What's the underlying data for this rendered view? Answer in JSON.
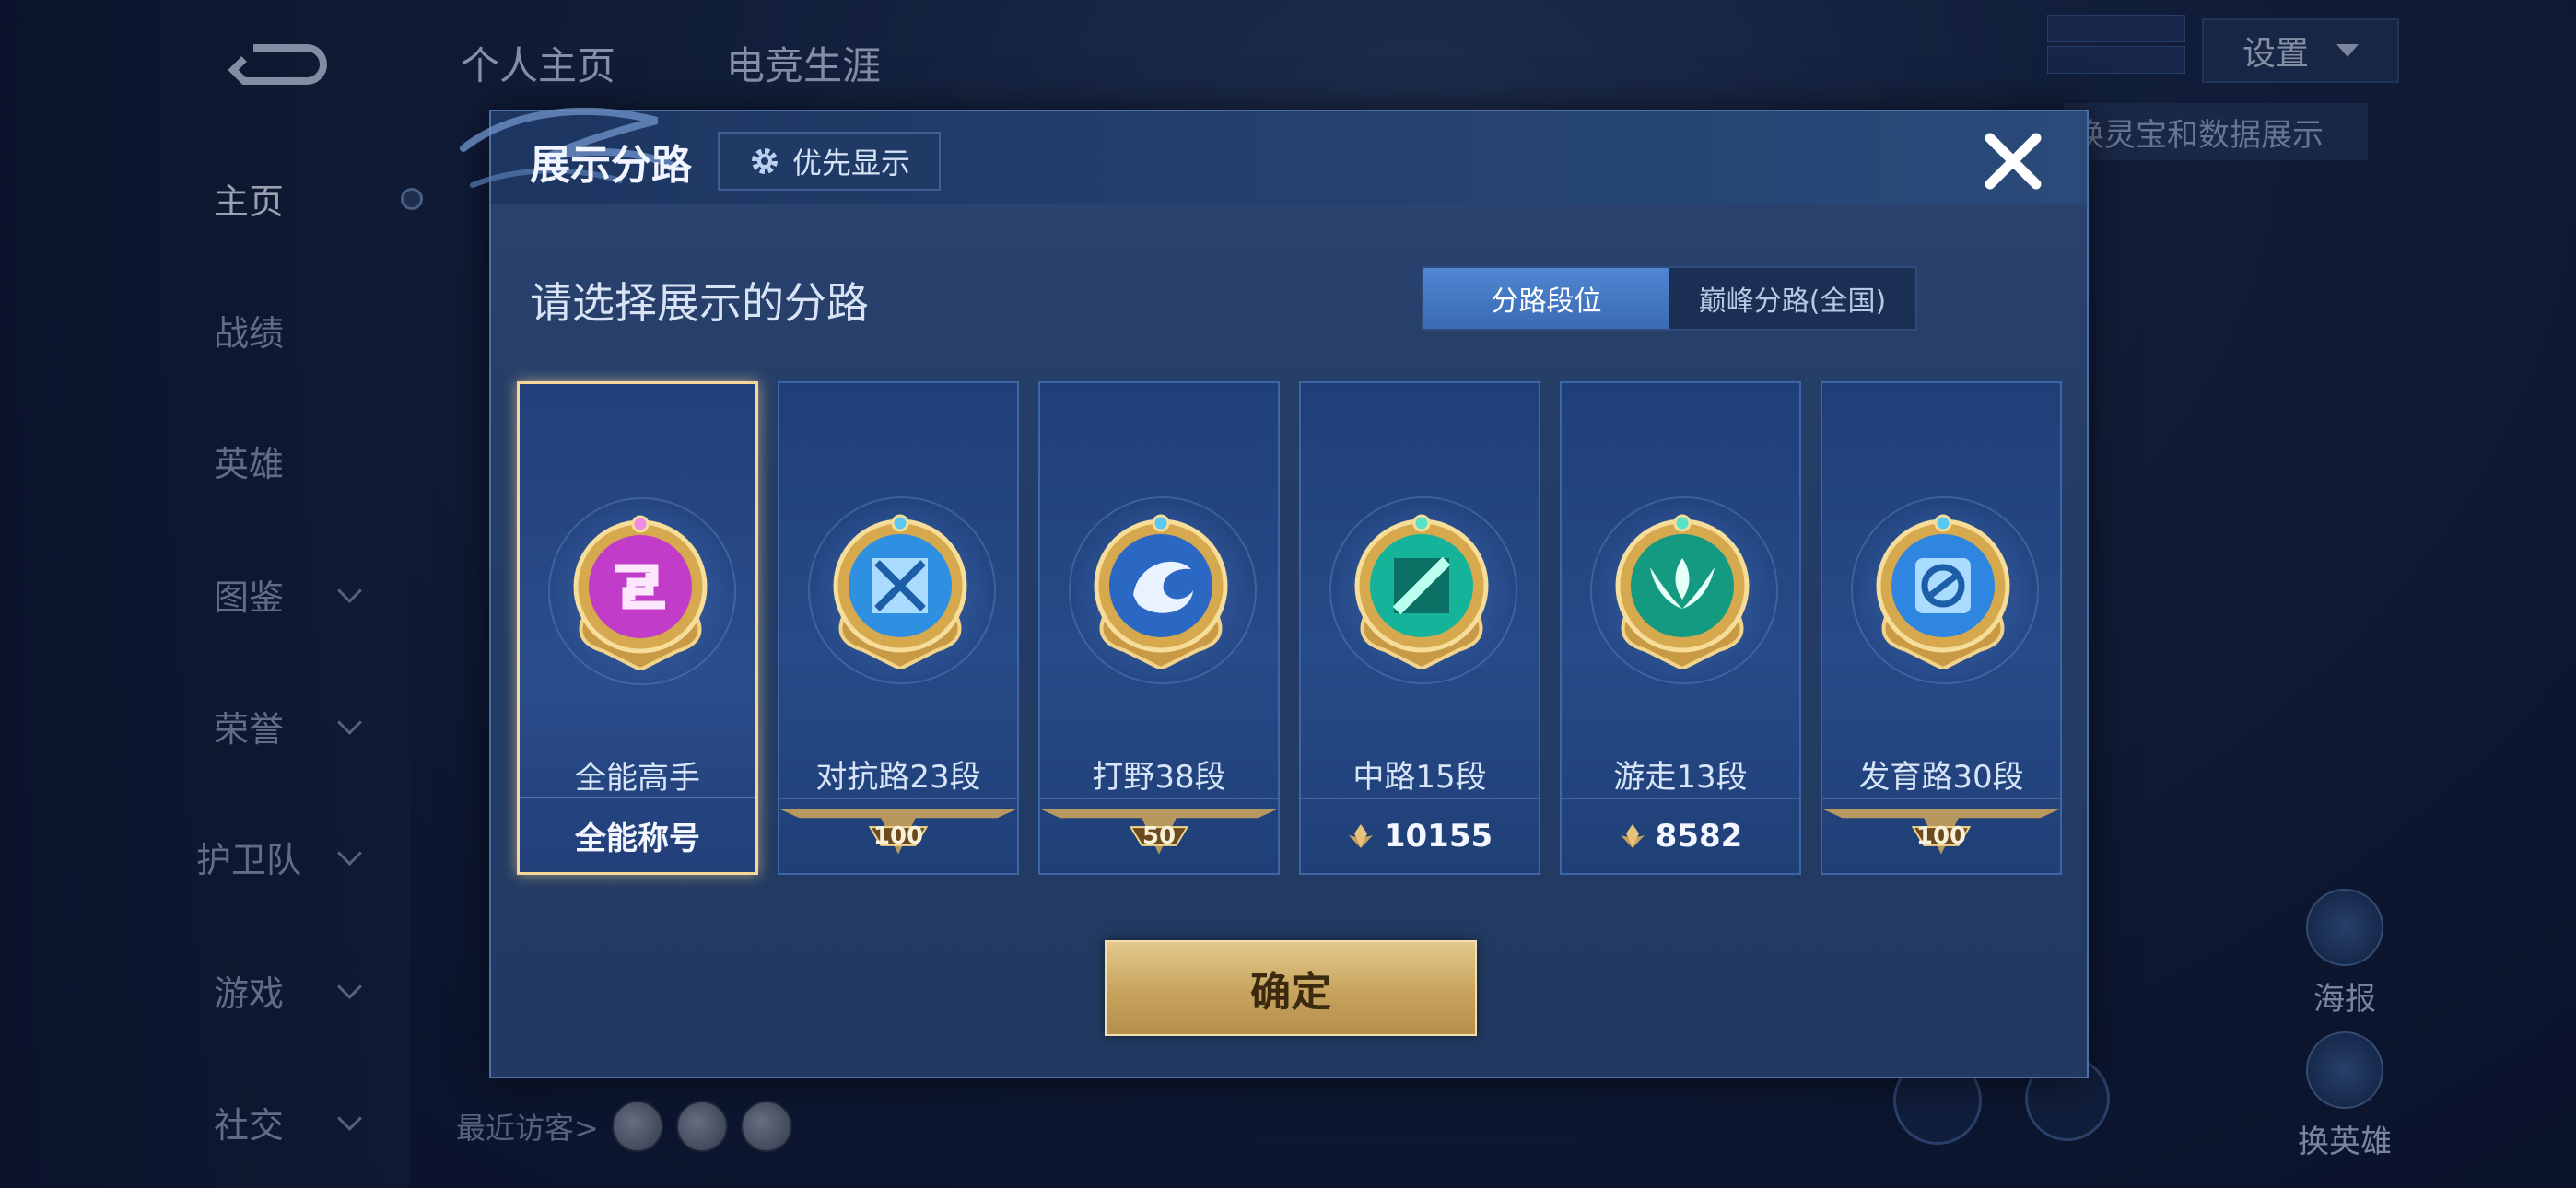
{
  "background": {
    "tabs": [
      "个人主页",
      "电竞生涯"
    ],
    "nav": [
      {
        "label": "主页",
        "active": true,
        "chevron": false
      },
      {
        "label": "战绩",
        "active": false,
        "chevron": false
      },
      {
        "label": "英雄",
        "active": false,
        "chevron": false
      },
      {
        "label": "图鉴",
        "active": false,
        "chevron": true
      },
      {
        "label": "荣誉",
        "active": false,
        "chevron": true
      },
      {
        "label": "护卫队",
        "active": false,
        "chevron": true
      },
      {
        "label": "游戏",
        "active": false,
        "chevron": true
      },
      {
        "label": "社交",
        "active": false,
        "chevron": true
      }
    ],
    "settings_label": "设置",
    "strip_text": "换灵宝和数据展示",
    "poster_label": "海报",
    "switch_hero_label": "换英雄",
    "recent_visitors_label": "最近访客>"
  },
  "dialog": {
    "title": "展示分路",
    "priority_label": "优先显示",
    "subtitle": "请选择展示的分路",
    "segments": [
      {
        "label": "分路段位",
        "active": true
      },
      {
        "label": "巅峰分路(全国)",
        "active": false
      }
    ],
    "cards": [
      {
        "name": "全能高手",
        "footer": "全能称号",
        "selected": true,
        "icon": "allround-icon",
        "color": "#c13cc8"
      },
      {
        "name": "对抗路23段",
        "rank": "100",
        "selected": false,
        "icon": "clash-lane-icon",
        "color": "#2f8fe0"
      },
      {
        "name": "打野38段",
        "rank": "50",
        "selected": false,
        "icon": "jungle-icon",
        "color": "#2b68c4"
      },
      {
        "name": "中路15段",
        "score": "10155",
        "selected": false,
        "icon": "mid-lane-icon",
        "color": "#15b39a"
      },
      {
        "name": "游走13段",
        "score": "8582",
        "selected": false,
        "icon": "roam-icon",
        "color": "#139a80"
      },
      {
        "name": "发育路30段",
        "rank": "100",
        "selected": false,
        "icon": "farm-lane-icon",
        "color": "#2e86e0"
      }
    ],
    "confirm_label": "确定"
  }
}
